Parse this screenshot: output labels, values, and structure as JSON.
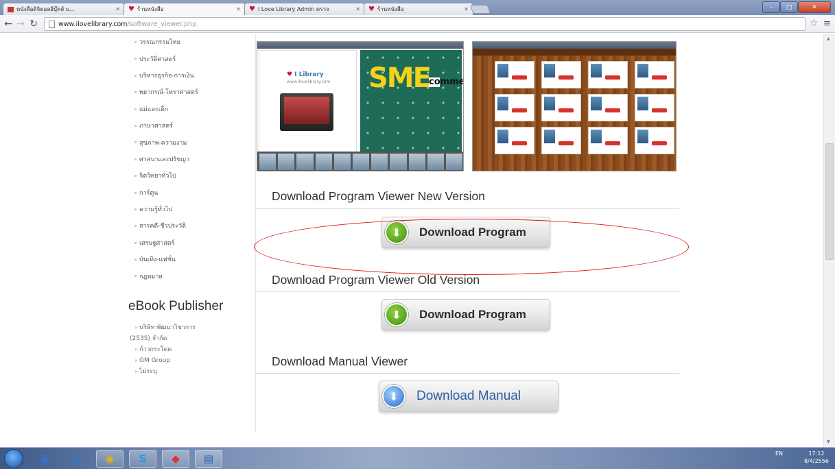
{
  "browser": {
    "tabs": [
      {
        "title": "หนังสือดิจิตอลอีบุ๊คส์ ม...",
        "active": false,
        "favicon": "gmail-icon"
      },
      {
        "title": "ร้านหนังสือ",
        "active": true,
        "favicon": "heart-icon"
      },
      {
        "title": "I Love Library Admin ตรวจ",
        "active": false,
        "favicon": "heart-icon"
      },
      {
        "title": "ร้านหนังสือ",
        "active": false,
        "favicon": "heart-icon"
      }
    ],
    "url_host": "www.ilovelibrary.com",
    "url_path": "/software_viewer.php"
  },
  "sidebar": {
    "categories": [
      "วรรณกรรมไทย",
      "ประวัติศาสตร์",
      "บริหารธุรกิจ-การเงิน",
      "พยากรณ์-โหราศาสตร์",
      "แม่และเด็ก",
      "ภาษาศาสตร์",
      "สุขภาพ-ความงาม",
      "ศาสนาและปรัชญา",
      "จิตวิทยาทั่วไป",
      "การ์ตูน",
      "ความรู้ทั่วไป",
      "สารคดี-ชีวประวัติ",
      "เศรษฐศาสตร์",
      "บันเทิง-แฟชั่น",
      "กฎหมาย"
    ],
    "publisher_title": "eBook Publisher",
    "publishers": [
      "บริษัท พัฒนาวิชาการ",
      "(2535) จำกัด",
      "ก้าวกระโดด",
      "GM Group",
      "ไม่ระบุ"
    ]
  },
  "preview": {
    "logo_heart": "♥",
    "logo_text": "I Library",
    "logo_url": "www.ilovelibrary.com",
    "sme": "SME",
    "ecommerce": "commerce"
  },
  "sections": {
    "new_heading": "Download Program Viewer New Version",
    "new_button": "Download Program",
    "old_heading": "Download Program Viewer Old Version",
    "old_button": "Download Program",
    "manual_heading": "Download Manual Viewer",
    "manual_button": "Download Manual"
  },
  "taskbar": {
    "lang": "EN",
    "time": "17:12",
    "date": "8/4/2556"
  },
  "colors": {
    "highlight_oval": "#e01818",
    "button_green": "#3f8f14",
    "button_blue": "#2b6cc0"
  }
}
